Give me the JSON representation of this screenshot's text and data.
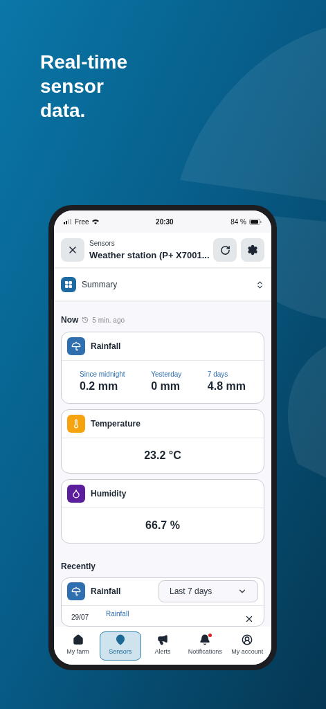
{
  "headline": "Real-time sensor data.",
  "status_bar": {
    "carrier": "Free",
    "time": "20:30",
    "battery": "84 %"
  },
  "header": {
    "subtitle": "Sensors",
    "title": "Weather station (P+ X7001..."
  },
  "view_select": {
    "value": "Summary"
  },
  "now": {
    "title": "Now",
    "updated": "5 min. ago"
  },
  "cards": [
    {
      "kind": "multi",
      "title": "Rainfall",
      "color": "#2f6fb0",
      "stats": [
        {
          "label": "Since midnight",
          "value": "0.2 mm"
        },
        {
          "label": "Yesterday",
          "value": "0 mm"
        },
        {
          "label": "7 days",
          "value": "4.8 mm"
        }
      ]
    },
    {
      "kind": "single",
      "title": "Temperature",
      "color": "#f5a30f",
      "value": "23.2 °C"
    },
    {
      "kind": "single",
      "title": "Humidity",
      "color": "#5b1e9c",
      "value": "66.7 %"
    }
  ],
  "recently": {
    "title": "Recently",
    "card": {
      "title": "Rainfall",
      "color": "#2f6fb0",
      "period": "Last 7 days",
      "rows": [
        {
          "date": "29/07",
          "label": "Rainfall"
        }
      ]
    }
  },
  "nav": [
    {
      "label": "My farm",
      "selected": false,
      "badge": false
    },
    {
      "label": "Sensors",
      "selected": true,
      "badge": false
    },
    {
      "label": "Alerts",
      "selected": false,
      "badge": false
    },
    {
      "label": "Notifications",
      "selected": false,
      "badge": true
    },
    {
      "label": "My account",
      "selected": false,
      "badge": false
    }
  ]
}
